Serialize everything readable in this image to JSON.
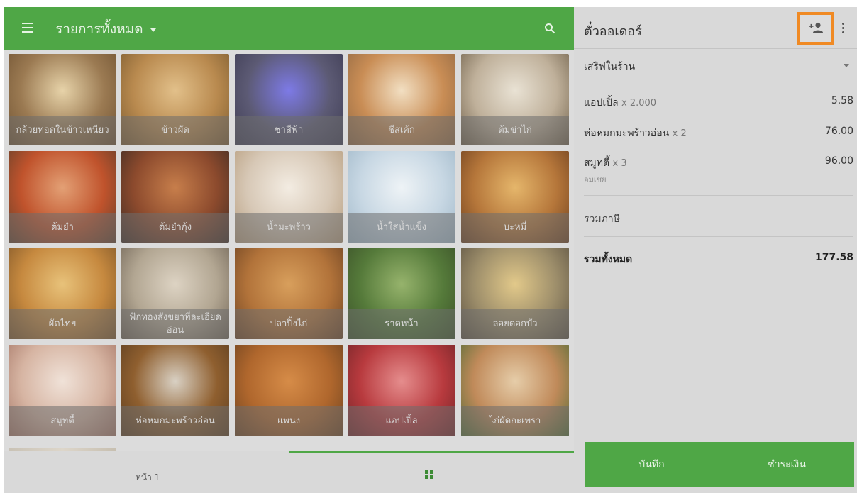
{
  "header": {
    "category_title": "รายการทั้งหมด"
  },
  "menu_items": [
    {
      "label": "กล้วยทอดในข้าวเหนียว",
      "colors": [
        "#9b7a52",
        "#e7d3a9",
        "#6e5131"
      ]
    },
    {
      "label": "ข้าวผัด",
      "colors": [
        "#b98a4f",
        "#e2c08a",
        "#7a5a2f"
      ]
    },
    {
      "label": "ชาสีฟ้า",
      "colors": [
        "#5c5a74",
        "#7d7ae6",
        "#3d3b52"
      ]
    },
    {
      "label": "ชีสเค้ก",
      "colors": [
        "#c98d55",
        "#f2dfc2",
        "#8f6742"
      ]
    },
    {
      "label": "ต้มข่าไก่",
      "colors": [
        "#bfb09a",
        "#e9e2d4",
        "#6d5e48"
      ]
    },
    {
      "label": "ต้มยำ",
      "colors": [
        "#c0532c",
        "#e3a075",
        "#5f3f2a"
      ]
    },
    {
      "label": "ต้มยำกุ้ง",
      "colors": [
        "#8c4a2d",
        "#c77e4b",
        "#3d2c24"
      ]
    },
    {
      "label": "น้ำมะพร้าว",
      "colors": [
        "#d7c8b6",
        "#f3ece2",
        "#b59b7b"
      ]
    },
    {
      "label": "น้ำใสน้ำแข็ง",
      "colors": [
        "#c7d7e3",
        "#eef3f6",
        "#9fb7c8"
      ]
    },
    {
      "label": "บะหมี่",
      "colors": [
        "#b5763a",
        "#e5b66b",
        "#6c3f1e"
      ]
    },
    {
      "label": "ผัดไทย",
      "colors": [
        "#c6893f",
        "#e8c27a",
        "#7b5327"
      ]
    },
    {
      "label": "ฟักทองสังขยาที่ละเอียดอ่อน",
      "colors": [
        "#b2a692",
        "#ddd3c3",
        "#6e6254"
      ]
    },
    {
      "label": "ปลาปิ้งไก่",
      "colors": [
        "#b2733a",
        "#d89f5c",
        "#6b4222"
      ]
    },
    {
      "label": "ราดหน้า",
      "colors": [
        "#557a3a",
        "#96b36c",
        "#3a4f28"
      ]
    },
    {
      "label": "ลอยดอกบัว",
      "colors": [
        "#9c8d6a",
        "#e2c98a",
        "#5a5041"
      ]
    },
    {
      "label": "สมูทตี้",
      "colors": [
        "#d6b4a2",
        "#f0e2d8",
        "#a57565"
      ]
    },
    {
      "label": "ห่อหมกมะพร้าวอ่อน",
      "colors": [
        "#8f5f2f",
        "#d9d1c4",
        "#5b3d20"
      ]
    },
    {
      "label": "แพนง",
      "colors": [
        "#b0672d",
        "#d68c48",
        "#6b4220"
      ]
    },
    {
      "label": "แอปเปิ้ล",
      "colors": [
        "#b83a3e",
        "#e58d8d",
        "#6e2427"
      ]
    },
    {
      "label": "ไก่ผัดกะเพรา",
      "colors": [
        "#c08a5a",
        "#e6cda9",
        "#4f6b34"
      ]
    }
  ],
  "footer": {
    "page_label": "หน้า 1"
  },
  "order": {
    "title": "ตั๋วออเดอร์",
    "dining_option": "เสริฟในร้าน",
    "items": [
      {
        "name": "แอปเปิ้ล",
        "qty": "x 2.000",
        "price": "5.58",
        "note": ""
      },
      {
        "name": "ห่อหมกมะพร้าวอ่อน",
        "qty": "x 2",
        "price": "76.00",
        "note": ""
      },
      {
        "name": "สมูทตี้",
        "qty": "x 3",
        "price": "96.00",
        "note": "อมเชย"
      }
    ],
    "tax_label": "รวมภาษี",
    "total_label": "รวมทั้งหมด",
    "total_value": "177.58",
    "save_label": "บันทึก",
    "pay_label": "ชำระเงิน"
  }
}
